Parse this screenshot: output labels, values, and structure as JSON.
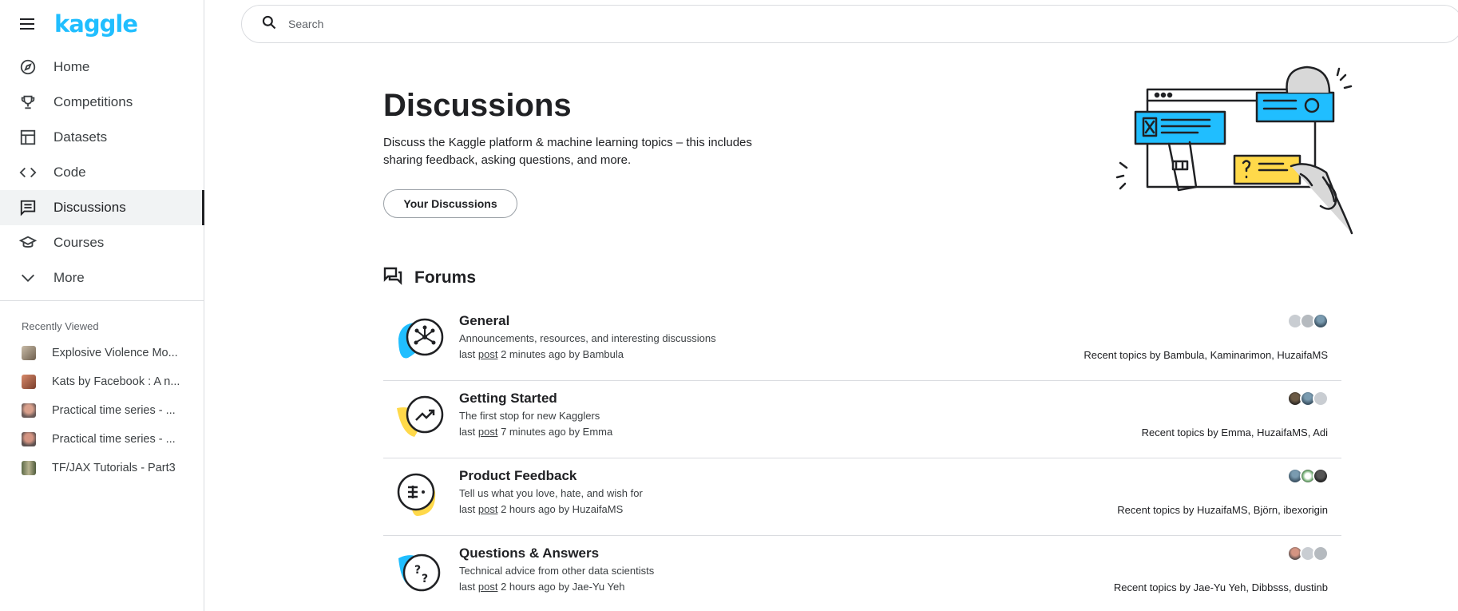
{
  "brand": {
    "logo_text": "kaggle",
    "accent": "#20beff"
  },
  "search": {
    "placeholder": "Search"
  },
  "sidebar": {
    "items": [
      {
        "label": "Home",
        "icon": "compass-icon"
      },
      {
        "label": "Competitions",
        "icon": "trophy-icon"
      },
      {
        "label": "Datasets",
        "icon": "table-icon"
      },
      {
        "label": "Code",
        "icon": "code-icon"
      },
      {
        "label": "Discussions",
        "icon": "comment-icon",
        "active": true
      },
      {
        "label": "Courses",
        "icon": "school-icon"
      },
      {
        "label": "More",
        "icon": "chevron-down-icon"
      }
    ],
    "recently_viewed_title": "Recently Viewed",
    "recently_viewed": [
      {
        "label": "Explosive Violence Mo...",
        "thumb": "#9e8c74"
      },
      {
        "label": "Kats by Facebook : A n...",
        "thumb": "#b0654a"
      },
      {
        "label": "Practical time series - ...",
        "thumb": "#c08a78"
      },
      {
        "label": "Practical time series - ...",
        "thumb": "#b77d6e"
      },
      {
        "label": "TF/JAX Tutorials - Part3",
        "thumb": "#7f8f6a"
      }
    ]
  },
  "main": {
    "title": "Discussions",
    "description": "Discuss the Kaggle platform & machine learning topics – this includes sharing feedback, asking questions, and more.",
    "your_discussions_label": "Your Discussions",
    "forums_title": "Forums"
  },
  "forums": [
    {
      "name": "General",
      "description": "Announcements, resources, and interesting discussions",
      "last_prefix": "last",
      "post_word": "post",
      "last_suffix": "2 minutes ago by Bambula",
      "recent": "Recent topics by Bambula, Kaminarimon, HuzaifaMS",
      "icon": "network-icon",
      "blob_color": "#20beff"
    },
    {
      "name": "Getting Started",
      "description": "The first stop for new Kagglers",
      "last_prefix": "last",
      "post_word": "post",
      "last_suffix": "7 minutes ago by Emma",
      "recent": "Recent topics by Emma, HuzaifaMS, Adi",
      "icon": "trending-up-icon",
      "blob_color": "#ffd94a"
    },
    {
      "name": "Product Feedback",
      "description": "Tell us what you love, hate, and wish for",
      "last_prefix": "last",
      "post_word": "post",
      "last_suffix": "2 hours ago by HuzaifaMS",
      "recent": "Recent topics by HuzaifaMS, Björn, ibexorigin",
      "icon": "feedback-icon",
      "blob_color": "#ffd94a"
    },
    {
      "name": "Questions & Answers",
      "description": "Technical advice from other data scientists",
      "last_prefix": "last",
      "post_word": "post",
      "last_suffix": "2 hours ago by Jae-Yu Yeh",
      "recent": "Recent topics by Jae-Yu Yeh, Dibbsss, dustinb",
      "icon": "question-icon",
      "blob_color": "#20beff"
    }
  ]
}
